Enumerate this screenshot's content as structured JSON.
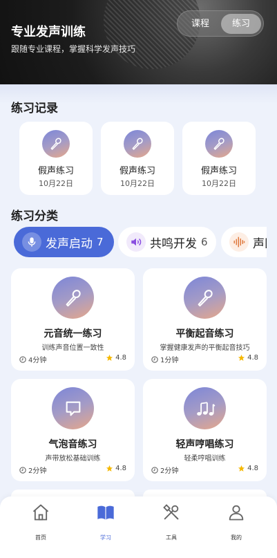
{
  "header": {
    "title": "专业发声训练",
    "subtitle": "跟随专业课程，掌握科学发声技巧",
    "segment": {
      "options": [
        "课程",
        "练习"
      ],
      "selected": "练习"
    }
  },
  "records": {
    "title": "练习记录",
    "items": [
      {
        "name": "假声练习",
        "date": "10月22日",
        "icon": "microphone-icon"
      },
      {
        "name": "假声练习",
        "date": "10月22日",
        "icon": "microphone-icon"
      },
      {
        "name": "假声练习",
        "date": "10月22日",
        "icon": "microphone-icon"
      }
    ]
  },
  "categories": {
    "title": "练习分类",
    "chips": [
      {
        "label": "发声启动",
        "count": "7",
        "icon": "microphone-icon",
        "active": true
      },
      {
        "label": "共鸣开发",
        "count": "6",
        "icon": "speaker-icon",
        "active": false
      },
      {
        "label": "声区",
        "count": "",
        "icon": "waveform-icon",
        "active": false
      }
    ],
    "cards": [
      {
        "name": "元音统一练习",
        "desc": "训练声音位置一致性",
        "duration": "4分钟",
        "rating": "4.8",
        "icon": "microphone-icon"
      },
      {
        "name": "平衡起音练习",
        "desc": "掌握健康发声的平衡起音技巧",
        "duration": "1分钟",
        "rating": "4.8",
        "icon": "microphone-icon"
      },
      {
        "name": "气泡音练习",
        "desc": "声带放松基础训练",
        "duration": "2分钟",
        "rating": "4.8",
        "icon": "chat-bubble-icon"
      },
      {
        "name": "轻声哼唱练习",
        "desc": "轻柔哼唱训练",
        "duration": "2分钟",
        "rating": "4.8",
        "icon": "music-notes-icon"
      }
    ]
  },
  "tabbar": {
    "items": [
      {
        "label": "首页",
        "icon": "home-icon",
        "active": false
      },
      {
        "label": "学习",
        "icon": "book-icon",
        "active": true
      },
      {
        "label": "工具",
        "icon": "tools-icon",
        "active": false
      },
      {
        "label": "我的",
        "icon": "user-icon",
        "active": false
      }
    ]
  },
  "colors": {
    "accent": "#4a6ad8",
    "star": "#f5b800",
    "background": "#eef2fb"
  }
}
